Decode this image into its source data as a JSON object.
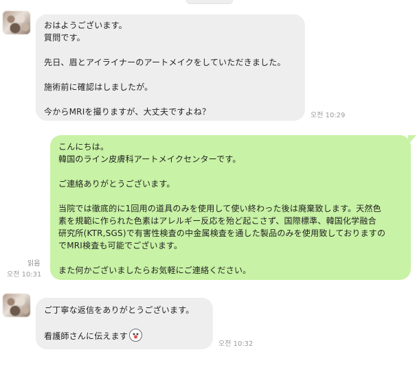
{
  "chat": {
    "messages": [
      {
        "sender": "other",
        "lines": [
          "おはようございます。",
          "質問です。",
          "",
          "先日、眉とアイライナーのアートメイクをしていただきました。",
          "",
          "施術前に確認はしましたが。",
          "",
          "今からMRIを撮りますが、大丈夫ですよね？"
        ],
        "time": "오전 10:29"
      },
      {
        "sender": "me",
        "lines": [
          "こんにちは。",
          "韓国のライン皮膚科アートメイクセンターです。",
          "",
          "ご連絡ありがとうございます。",
          "",
          "当院では徹底的に1回用の道具のみを使用して使い終わった後は廃棄致します。天然色",
          "素を規範に作られた色素はアレルギー反応を殆ど起こさず、国際標準、韓国化学融合",
          "研究所(KTR,SGS)で有害性検査の中金属検査を通した製品のみを使用致しておりますの",
          "でMRI検査も可能でございます。",
          "",
          "また何かございましたらお気軽にご連絡ください。"
        ],
        "read_label": "읽음",
        "time": "오전 10:31"
      },
      {
        "sender": "other",
        "lines": [
          "ご丁寧な返信をありがとうございます。",
          "",
          "看護師さんに伝えます"
        ],
        "sticker_icon": "smiling-face-sticker-icon",
        "time": "오전 10:32"
      }
    ]
  },
  "colors": {
    "incoming_bubble": "#eeeeee",
    "outgoing_bubble": "#c8f2a5",
    "meta_text": "#9a9a9a"
  }
}
